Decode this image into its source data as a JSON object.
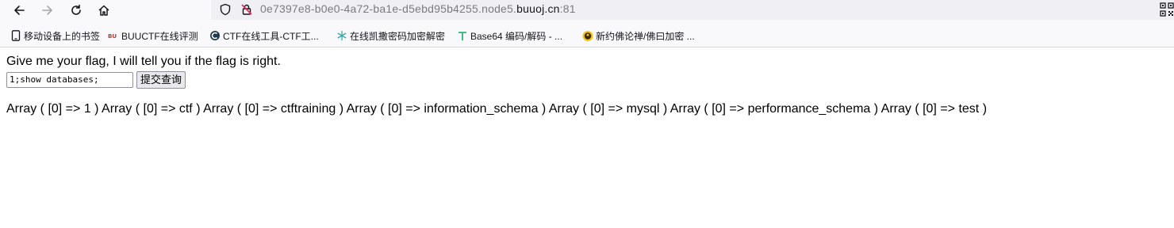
{
  "browser": {
    "url_prefix": "0e7397e8-b0e0-4a72-ba1e-d5ebd95b4255.node5.",
    "url_domain": "buuoj.cn",
    "url_port": ":81"
  },
  "bookmarks": [
    {
      "label": "移动设备上的书签",
      "icon": "mobile-icon"
    },
    {
      "label": "BUUCTF在线评测",
      "icon": "buuctf-icon"
    },
    {
      "label": "CTF在线工具-CTF工...",
      "icon": "ctf-tools-icon"
    },
    {
      "label": "在线凯撒密码加密解密",
      "icon": "snowflake-icon"
    },
    {
      "label": "Base64 编码/解码 - ...",
      "icon": "t-logo-icon"
    },
    {
      "label": "新约佛论禅/佛曰加密 ...",
      "icon": "buddha-icon"
    }
  ],
  "page": {
    "prompt": "Give me your flag, I will tell you if the flag is right.",
    "input_value": "1;show databases;",
    "submit_label": "提交查询",
    "result": "Array ( [0] => 1 ) Array ( [0] => ctf ) Array ( [0] => ctftraining ) Array ( [0] => information_schema ) Array ( [0] => mysql ) Array ( [0] => performance_schema ) Array ( [0] => test )"
  },
  "colors": {
    "chrome_bg": "#f9f9fb",
    "urlbar_bg": "#f0f0f4",
    "url_dim": "#7a7a80",
    "button_bg": "#e9e9ed"
  }
}
